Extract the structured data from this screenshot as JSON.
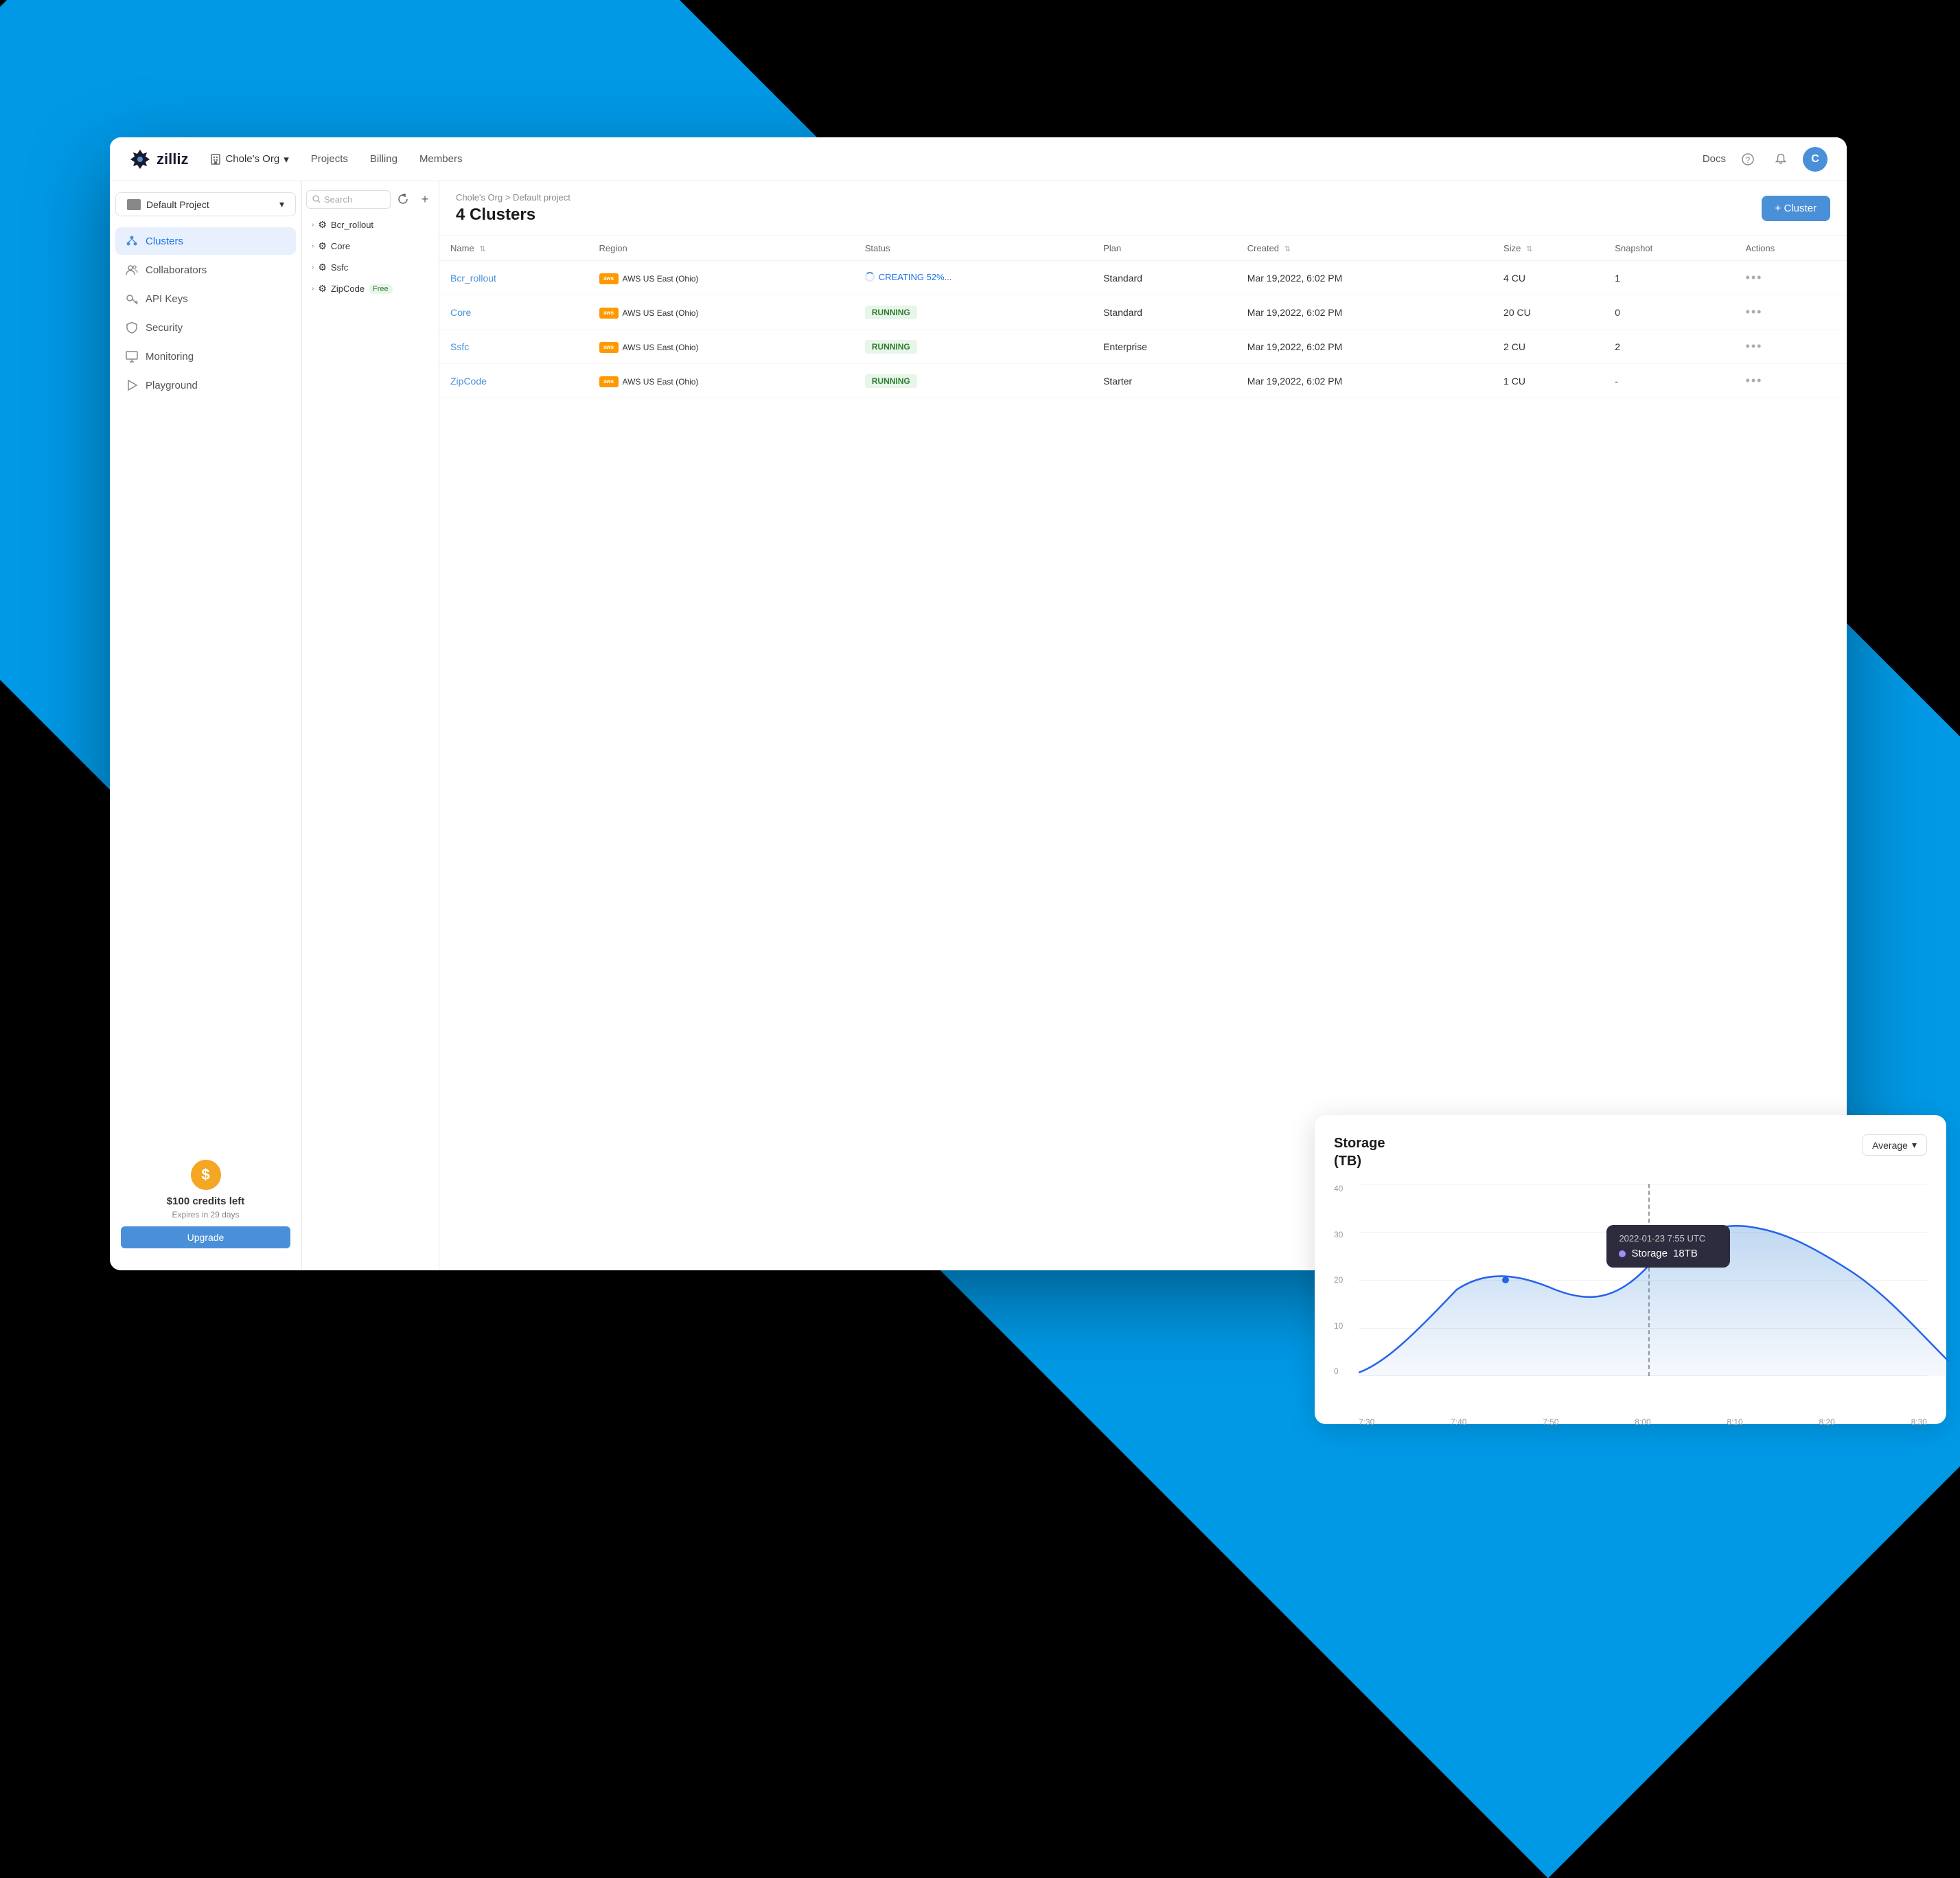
{
  "app": {
    "logo": "zilliz",
    "logo_star": "✳",
    "org_name": "Chole's Org",
    "nav_links": [
      "Projects",
      "Billing",
      "Members"
    ],
    "nav_docs": "Docs",
    "nav_avatar": "C"
  },
  "sidebar": {
    "project_selector": "Default Project",
    "items": [
      {
        "id": "clusters",
        "label": "Clusters",
        "icon": "cluster",
        "active": true
      },
      {
        "id": "collaborators",
        "label": "Collaborators",
        "icon": "collaborators",
        "active": false
      },
      {
        "id": "api-keys",
        "label": "API Keys",
        "icon": "key",
        "active": false
      },
      {
        "id": "security",
        "label": "Security",
        "icon": "shield",
        "active": false
      },
      {
        "id": "monitoring",
        "label": "Monitoring",
        "icon": "monitor",
        "active": false
      },
      {
        "id": "playground",
        "label": "Playground",
        "icon": "play",
        "active": false
      }
    ],
    "credits": {
      "icon": "$",
      "amount": "$100 credits left",
      "expires": "Expires in 29 days",
      "upgrade_label": "Upgrade"
    }
  },
  "tree": {
    "search_placeholder": "Search",
    "items": [
      {
        "id": "bcr_rollout",
        "label": "Bcr_rollout",
        "expanded": false
      },
      {
        "id": "core",
        "label": "Core",
        "expanded": false
      },
      {
        "id": "ssfc",
        "label": "Ssfc",
        "expanded": false
      },
      {
        "id": "zipcode",
        "label": "ZipCode",
        "badge": "Free",
        "expanded": false
      }
    ]
  },
  "main": {
    "breadcrumb": "Chole's Org > Default project",
    "page_title": "4 Clusters",
    "add_cluster_label": "+ Cluster",
    "table": {
      "columns": [
        "Name",
        "Region",
        "Status",
        "Plan",
        "Created",
        "Size",
        "Snapshot",
        "Actions"
      ],
      "rows": [
        {
          "name": "Bcr_rollout",
          "region": "AWS US East (Ohio)",
          "status": "CREATING 52%...",
          "status_type": "creating",
          "plan": "Standard",
          "created": "Mar 19,2022, 6:02 PM",
          "size": "4 CU",
          "snapshot": "1",
          "actions": "..."
        },
        {
          "name": "Core",
          "region": "AWS US East (Ohio)",
          "status": "RUNNING",
          "status_type": "running",
          "plan": "Standard",
          "created": "Mar 19,2022, 6:02 PM",
          "size": "20 CU",
          "snapshot": "0",
          "actions": "..."
        },
        {
          "name": "Ssfc",
          "region": "AWS US East (Ohio)",
          "status": "RUNNING",
          "status_type": "running",
          "plan": "Enterprise",
          "created": "Mar 19,2022, 6:02 PM",
          "size": "2 CU",
          "snapshot": "2",
          "actions": "..."
        },
        {
          "name": "ZipCode",
          "region": "AWS US East (Ohio)",
          "status": "RUNNING",
          "status_type": "running",
          "plan": "Starter",
          "created": "Mar 19,2022, 6:02 PM",
          "size": "1 CU",
          "snapshot": "-",
          "actions": "..."
        }
      ]
    }
  },
  "chart": {
    "title": "Storage\n(TB)",
    "dropdown_label": "Average",
    "y_labels": [
      "0",
      "10",
      "20",
      "30",
      "40"
    ],
    "x_labels": [
      "7:30",
      "7:40",
      "7:50",
      "8:00",
      "8:10",
      "8:20",
      "8:30"
    ],
    "tooltip": {
      "date": "2022-01-23 7:55 UTC",
      "dot_color": "#a78bfa",
      "label": "Storage",
      "value": "18TB"
    }
  }
}
